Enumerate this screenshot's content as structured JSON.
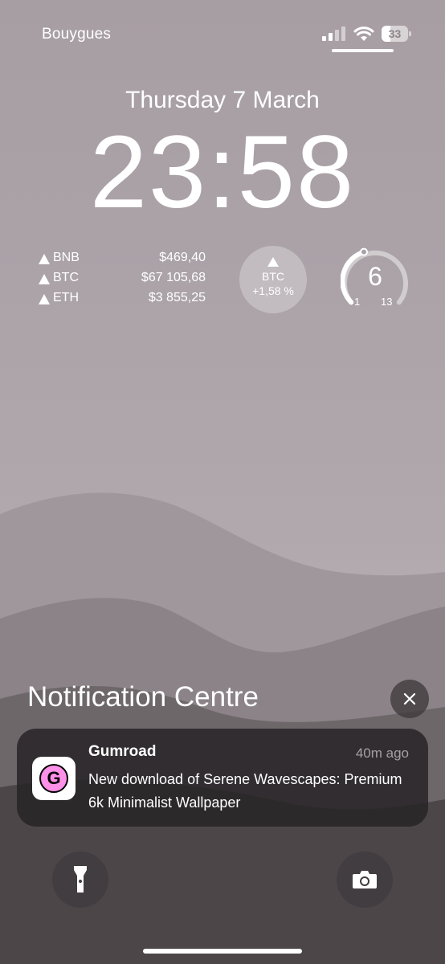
{
  "status_bar": {
    "carrier": "Bouygues",
    "battery": "33",
    "battery_level": 0.33
  },
  "lock_screen": {
    "date": "Thursday 7 March",
    "time": "23:58"
  },
  "crypto_widget": {
    "rows": [
      {
        "symbol": "BNB",
        "price": "$469,40"
      },
      {
        "symbol": "BTC",
        "price": "$67 105,68"
      },
      {
        "symbol": "ETH",
        "price": "$3 855,25"
      }
    ]
  },
  "btc_widget": {
    "label": "BTC",
    "change": "+1,58 %"
  },
  "gauge_widget": {
    "value": "6",
    "min": "1",
    "max": "13"
  },
  "notification_centre": {
    "title": "Notification Centre",
    "notification": {
      "app": "Gumroad",
      "icon_letter": "G",
      "time_ago": "40m ago",
      "message": "New download of Serene Wavescapes: Premium 6k Minimalist Wallpaper"
    }
  },
  "icons": {
    "signal": "cellular-signal-icon",
    "wifi": "wifi-icon",
    "battery": "battery-icon",
    "close": "close-icon",
    "flashlight": "flashlight-icon",
    "camera": "camera-icon"
  },
  "colors": {
    "gumroad_pink": "#ff90e8"
  }
}
